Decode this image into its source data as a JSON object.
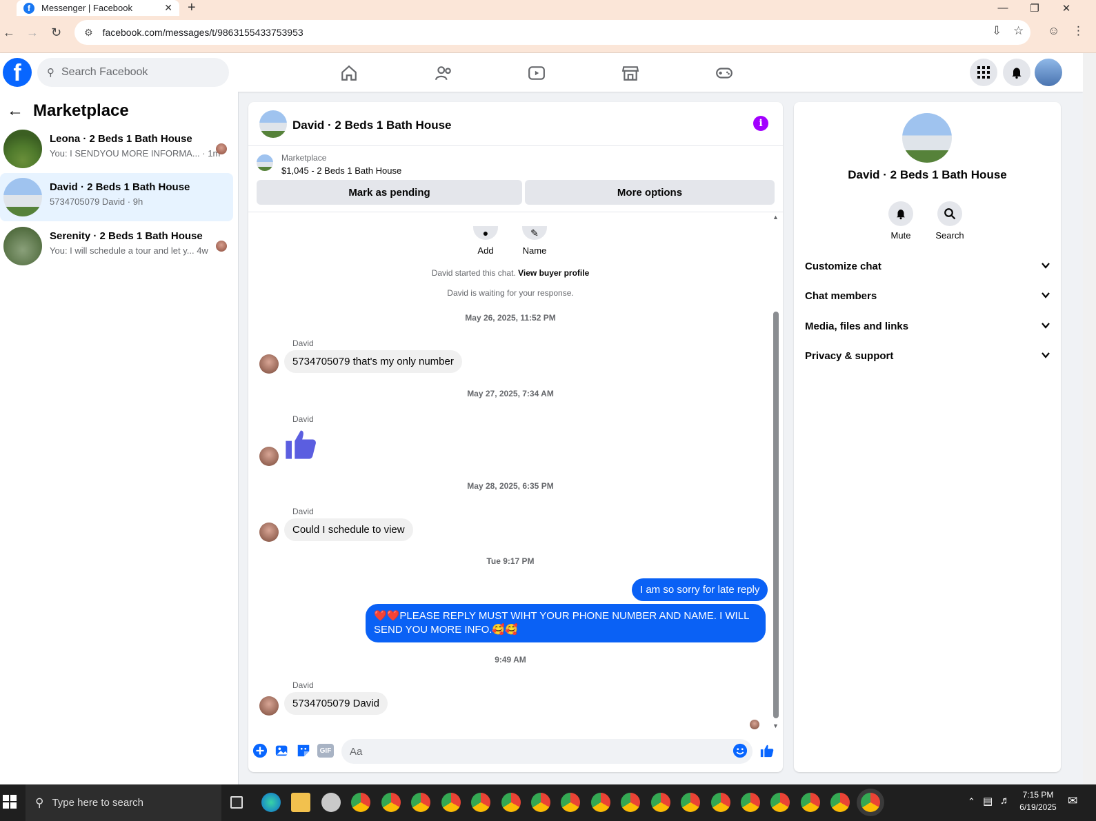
{
  "browser": {
    "tab_title": "Messenger | Facebook",
    "tab_close": "✕",
    "new_tab": "+",
    "url": "facebook.com/messages/t/9863155433753953"
  },
  "fbnav": {
    "logo_letter": "f",
    "search_placeholder": "Search Facebook"
  },
  "sidebar": {
    "title": "Marketplace",
    "conversations": [
      {
        "name": "Leona · 2 Beds 1 Bath House",
        "preview": "You: I SENDYOU MORE INFORMA...",
        "time": "1m"
      },
      {
        "name": "David · 2 Beds 1 Bath House",
        "preview": "5734705079 David",
        "time": "9h"
      },
      {
        "name": "Serenity · 2 Beds 1 Bath House",
        "preview": "You: I will schedule a tour and let y...",
        "time": "4w"
      }
    ]
  },
  "chat": {
    "title": "David · 2 Beds 1 Bath House",
    "marketplace_label": "Marketplace",
    "listing": "$1,045 - 2 Beds 1 Bath House",
    "mark_pending": "Mark as pending",
    "more_options": "More options",
    "quick_add": "Add",
    "quick_name": "Name",
    "started_prefix": "David started this chat.",
    "view_profile": "View buyer profile",
    "waiting": "David is waiting for your response.",
    "messages": [
      {
        "ts": "May 26, 2025, 11:52 PM",
        "sender": "David",
        "text": "5734705079 that's my only number"
      },
      {
        "ts": "May 27, 2025, 7:34 AM",
        "sender": "David",
        "text": "👍"
      },
      {
        "ts": "May 28, 2025, 6:35 PM",
        "sender": "David",
        "text": "Could I schedule to view"
      },
      {
        "ts": "Tue 9:17 PM",
        "out1": "I am so sorry for late reply",
        "out2": "❤️❤️PLEASE REPLY MUST WIHT YOUR PHONE NUMBER AND NAME. I WILL SEND YOU MORE INFO.🥰🥰"
      },
      {
        "ts": "9:49 AM",
        "sender": "David",
        "text": "5734705079 David"
      }
    ],
    "composer_placeholder": "Aa",
    "gif_label": "GIF"
  },
  "details": {
    "name": "David · 2 Beds 1 Bath House",
    "mute": "Mute",
    "search": "Search",
    "sections": [
      "Customize chat",
      "Chat members",
      "Media, files and links",
      "Privacy & support"
    ]
  },
  "taskbar": {
    "search_placeholder": "Type here to search",
    "time": "7:15 PM",
    "date": "6/19/2025"
  },
  "colors": {
    "fb_blue": "#0866ff",
    "outgoing_bubble": "#0a61f5",
    "info_purple": "#a200ff",
    "active_row": "#e7f3ff"
  }
}
